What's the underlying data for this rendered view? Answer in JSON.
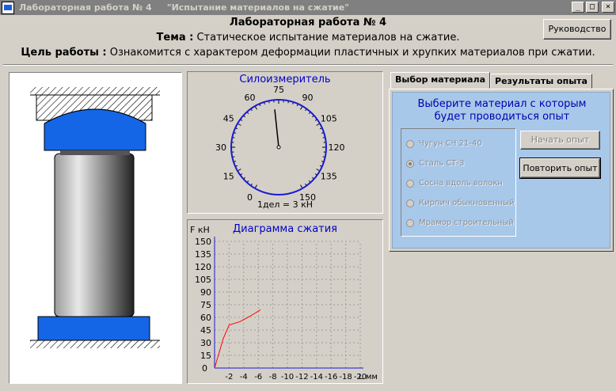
{
  "window": {
    "title": "Лабораторная работа № 4     \"Испытание материалов на сжатие\"",
    "controls": {
      "minimize": "_",
      "maximize": "□",
      "close": "×"
    }
  },
  "header": {
    "title": "Лабораторная работа № 4",
    "topic_label": "Тема :",
    "topic_text": " Статическое испытание материалов на сжатие.",
    "goal_label": "Цель работы :",
    "goal_text": " Ознакомится с характером деформации пластичных и хрупких материалов при сжатии.",
    "manual_button": "Руководство"
  },
  "gauge": {
    "title": "Силоизмеритель",
    "scale_labels": [
      "0",
      "15",
      "30",
      "45",
      "60",
      "75",
      "90",
      "105",
      "120",
      "135",
      "150"
    ],
    "division": "1дел = 3 кН",
    "needle_value": 72
  },
  "diagram": {
    "title": "Диаграмма сжатия",
    "y_axis_label": "F кН",
    "x_axis_label": "L мм",
    "y_ticks": [
      "150",
      "135",
      "120",
      "105",
      "90",
      "75",
      "60",
      "45",
      "30",
      "15",
      "0"
    ],
    "x_ticks": [
      "-2",
      "-4",
      "-6",
      "-8",
      "-10",
      "-12",
      "-14",
      "-16",
      "-18",
      "-20"
    ]
  },
  "chart_data": {
    "type": "line",
    "title": "Диаграмма сжатия",
    "xlabel": "L мм",
    "ylabel": "F кН",
    "xlim": [
      0,
      -20
    ],
    "ylim": [
      0,
      150
    ],
    "grid": true,
    "series": [
      {
        "color": "#ff0000",
        "x": [
          0,
          -1.2,
          -2,
          -3.5,
          -5.0,
          -6.3
        ],
        "y": [
          0,
          35,
          51,
          55,
          62,
          69
        ]
      }
    ]
  },
  "tabs": {
    "items": [
      "Выбор материала",
      "Результаты опыта"
    ],
    "active": 0
  },
  "material": {
    "prompt_line1": "Выберите материал с которым",
    "prompt_line2": "будет проводиться опыт",
    "options": [
      "Чугун СЧ 21-40",
      "Сталь СТ-3",
      "Сосна вдоль волокн",
      "Кирпич обыкновенный",
      "Мрамор строительный"
    ],
    "selected": 1,
    "start_button": "Начать опыт",
    "repeat_button": "Повторить опыт"
  },
  "colors": {
    "specimen_blue": "#1566e6",
    "label_blue": "#0000c8",
    "curve_red": "#ff0000",
    "tab_bg": "#a8c8ea"
  }
}
